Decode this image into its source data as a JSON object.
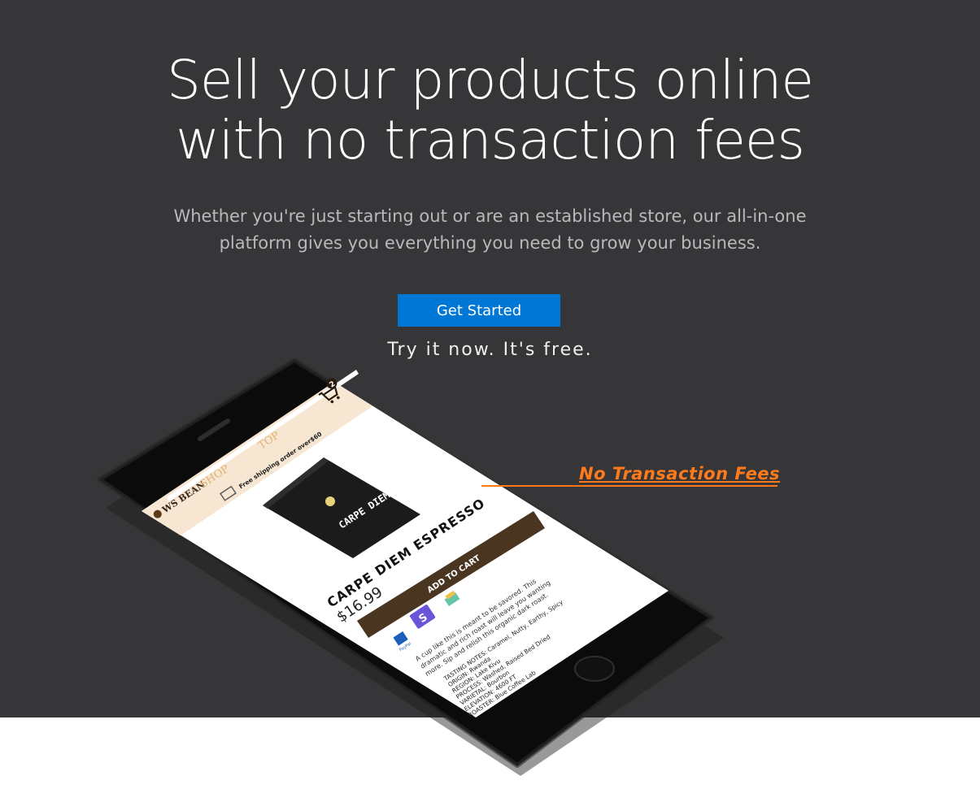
{
  "hero": {
    "headline_line1": "Sell your products online",
    "headline_line2": "with no transaction fees",
    "sub_line1": "Whether you're just starting out or are an established store, our all-in-one",
    "sub_line2": "platform gives you everything you need to grow your business.",
    "cta_label": "Get Started",
    "tagline": "Try it now. It's free."
  },
  "callout": {
    "label": "No Transaction Fees"
  },
  "phone_screen": {
    "brand": "WS BEAN",
    "nav_shop": "SHOP",
    "nav_top": "TOP",
    "cart_count": "2",
    "shipping_banner": "Free shipping order over$60",
    "bag_text": "CARPE DIEM",
    "product_title": "CARPE DIEM ESPRESSO",
    "price": "$16.99",
    "add_to_cart": "ADD TO CART",
    "pay_paypal": "PayPal",
    "pay_stripe": "S",
    "description": [
      "A cup like this is meant to be savored. This",
      "dramatic and rich roast will leave you wanting",
      "more. Sip and relish this organic dark roast."
    ],
    "details": [
      "TASTING NOTES: Caramel, Nutty, Earthy, Spicy",
      "ORIGIN: Rwanda",
      "REGION: Lake Kivu",
      "PROCESS: Washed, Raised Bed Dried",
      "VARIETAL: Bourbon",
      "ELEVATION: 4600 FT",
      "ROASTER: Blue Coffee Lab"
    ]
  },
  "colors": {
    "hero_bg": "#363638",
    "cta_bg": "#0077d4",
    "accent_orange": "#ff7a1a",
    "cart_button": "#4a3520"
  }
}
